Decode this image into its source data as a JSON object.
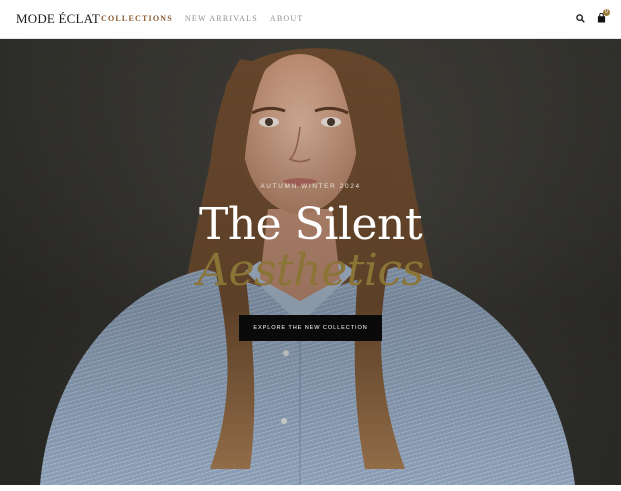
{
  "brand": {
    "logo_text": "MODE ÉCLAT"
  },
  "nav": {
    "items": [
      {
        "label": "COLLECTIONS",
        "active": true
      },
      {
        "label": "NEW ARRIVALS",
        "active": false
      },
      {
        "label": "ABOUT",
        "active": false
      }
    ]
  },
  "header_actions": {
    "search_icon": "search-icon",
    "bag_icon": "shopping-bag-icon",
    "bag_count": "0"
  },
  "hero": {
    "eyebrow": "AUTUMN WINTER 2024",
    "title_line1": "The Silent",
    "title_line2": "Aesthetics",
    "cta_label": "EXPLORE THE NEW COLLECTION",
    "image_alt": "Model with long brown hair wearing a light blue striped shirt"
  },
  "colors": {
    "accent": "#8a5a2b",
    "headline_accent": "#8a7436",
    "cta_bg": "#0a0a0a",
    "hero_bg": "#3a3934"
  }
}
